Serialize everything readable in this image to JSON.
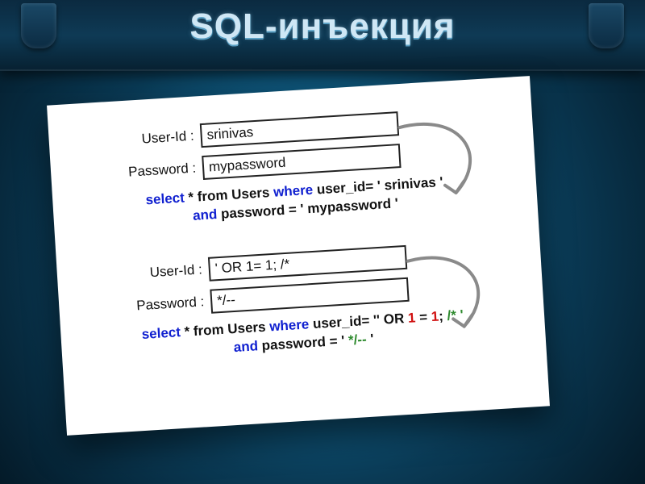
{
  "title": "SQL-инъекция",
  "example1": {
    "userid_label": "User-Id :",
    "userid_value": "srinivas",
    "password_label": "Password :",
    "password_value": "mypassword",
    "sql_line1": {
      "select": "select",
      "star_from": " * from ",
      "users": "Users",
      "where": " where ",
      "uid": "user_id= ' srinivas '"
    },
    "sql_line2": {
      "and": "and ",
      "pwd": "password = ' mypassword '"
    }
  },
  "example2": {
    "userid_label": "User-Id :",
    "userid_value": "' OR 1= 1; /*",
    "password_label": "Password :",
    "password_value": "*/--",
    "sql_line1": {
      "select": "select",
      "star_from": " * from ",
      "users": "Users",
      "where": " where ",
      "uid_prefix": "user_id= '",
      "inj_open": "' OR ",
      "one_a": "1",
      "eq": " = ",
      "one_b": "1",
      "semi": "; ",
      "cmt_open": "/* '"
    },
    "sql_line2": {
      "and": "and ",
      "pwd_prefix": "password = ' ",
      "cmt_close": "*/-- ",
      "tail": "'"
    }
  }
}
